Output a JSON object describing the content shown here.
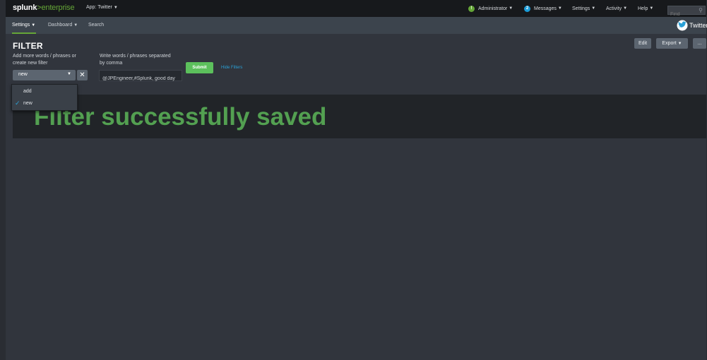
{
  "topbar": {
    "logo_main": "splunk",
    "logo_gt": ">",
    "logo_suffix": "enterprise",
    "app_menu": "App: Twitter",
    "admin_badge": "!",
    "admin_label": "Administrator",
    "messages_count": "2",
    "messages_label": "Messages",
    "settings_label": "Settings",
    "activity_label": "Activity",
    "help_label": "Help",
    "find_placeholder": "Find",
    "colors": {
      "bg": "#17191c",
      "brand_green": "#65a637",
      "badge_green": "#65a637",
      "badge_blue": "#1a9cd8"
    }
  },
  "nav": {
    "items": [
      {
        "label": "Settings",
        "has_caret": true,
        "active": true
      },
      {
        "label": "Dashboard",
        "has_caret": true,
        "active": false
      },
      {
        "label": "Search",
        "has_caret": false,
        "active": false
      }
    ],
    "app_title": "Twitter",
    "app_icon": "twitter-bird-icon"
  },
  "dashboard": {
    "title": "FILTER",
    "buttons": {
      "edit": "Edit",
      "export": "Export",
      "more": "..."
    }
  },
  "filters": {
    "select": {
      "label_line1": "Add more words / phrases or",
      "label_line2": "create new filter",
      "value": "new",
      "options": [
        {
          "label": "add",
          "selected": false
        },
        {
          "label": "new",
          "selected": true
        }
      ]
    },
    "text": {
      "label_line1": "Write words / phrases separated",
      "label_line2": "by comma",
      "value": "@JPEngineer,#Splunk, good day"
    },
    "submit_label": "Submit",
    "hide_filters_label": "Hide Filters",
    "submit_color": "#5cc05c"
  },
  "panel": {
    "message": "Filter successfully saved",
    "message_color": "#53a051"
  }
}
